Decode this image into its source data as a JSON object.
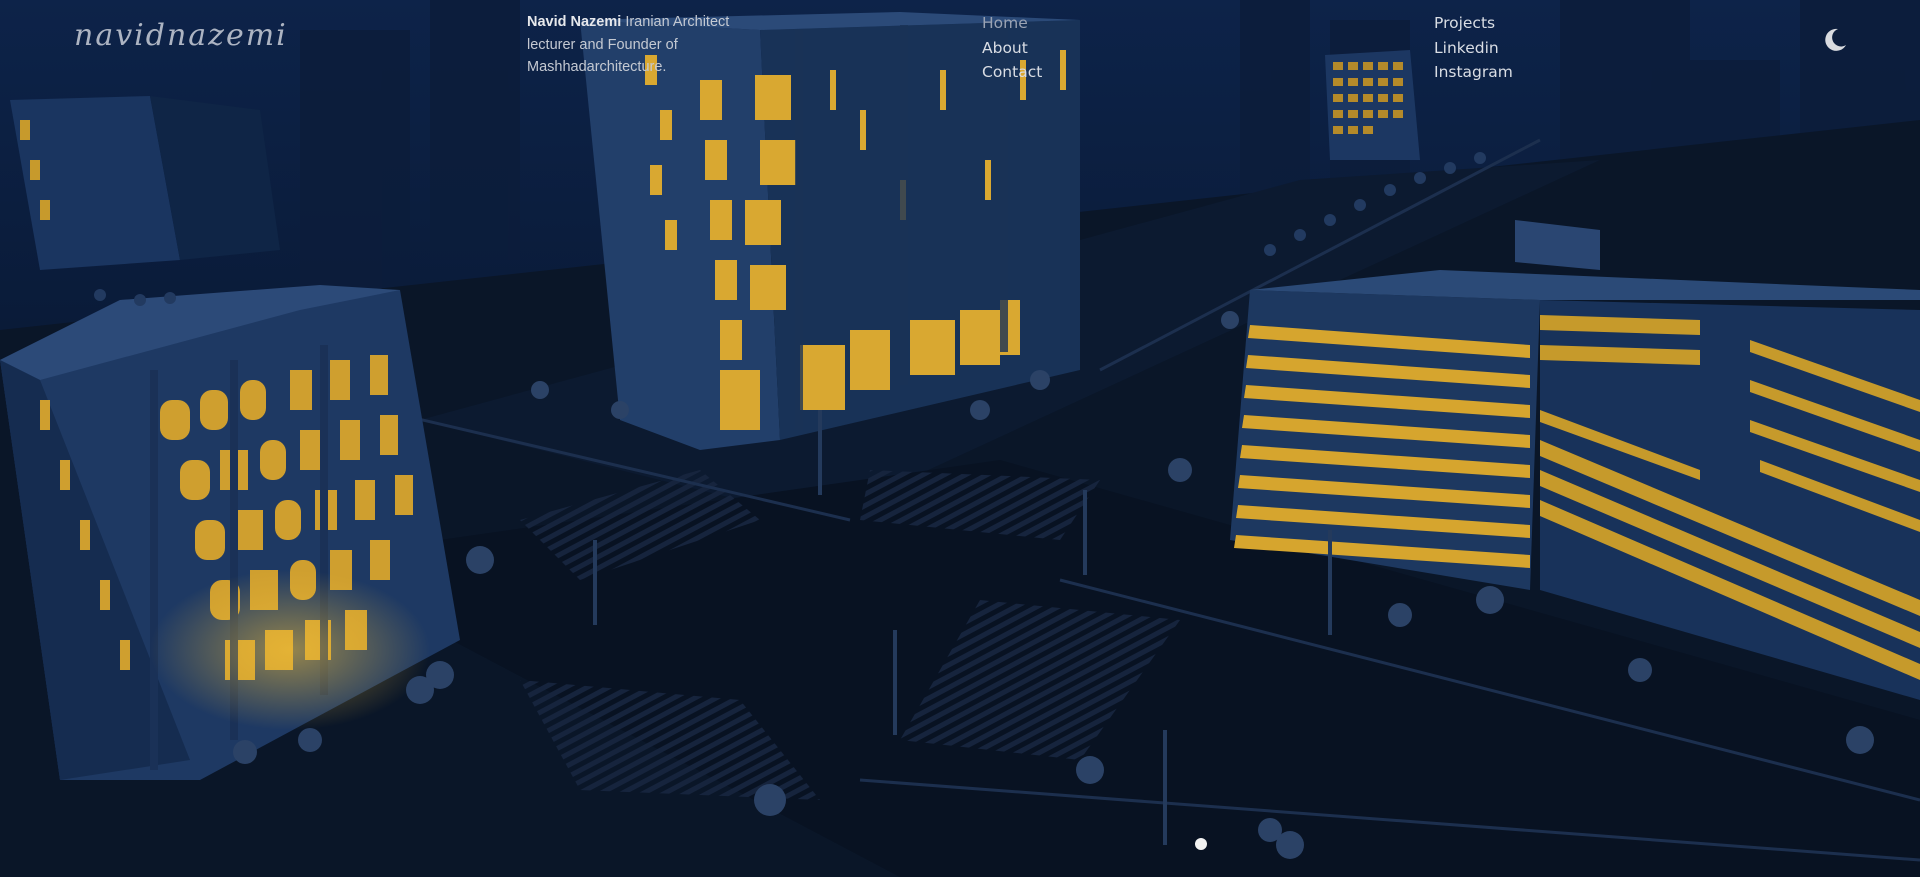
{
  "header": {
    "logo_text": "navidnazemi",
    "bio": {
      "name": "Navid Nazemi",
      "description": "Iranian Architect lecturer and Founder of Mashhadarchitecture."
    },
    "nav_main": [
      {
        "label": "Home",
        "active": true
      },
      {
        "label": "About",
        "active": false
      },
      {
        "label": "Contact",
        "active": false
      }
    ],
    "nav_external": [
      {
        "label": "Projects"
      },
      {
        "label": "Linkedin"
      },
      {
        "label": "Instagram"
      }
    ],
    "theme_toggle_icon": "moon-icon"
  },
  "scene": {
    "description_icon": "night-city-3d-scene",
    "window_light_color": "#e8b532",
    "night_sky_color": "#061126",
    "building_color": "#1f3a63"
  },
  "scroll_indicator": {
    "icon": "scroll-dot-icon"
  }
}
